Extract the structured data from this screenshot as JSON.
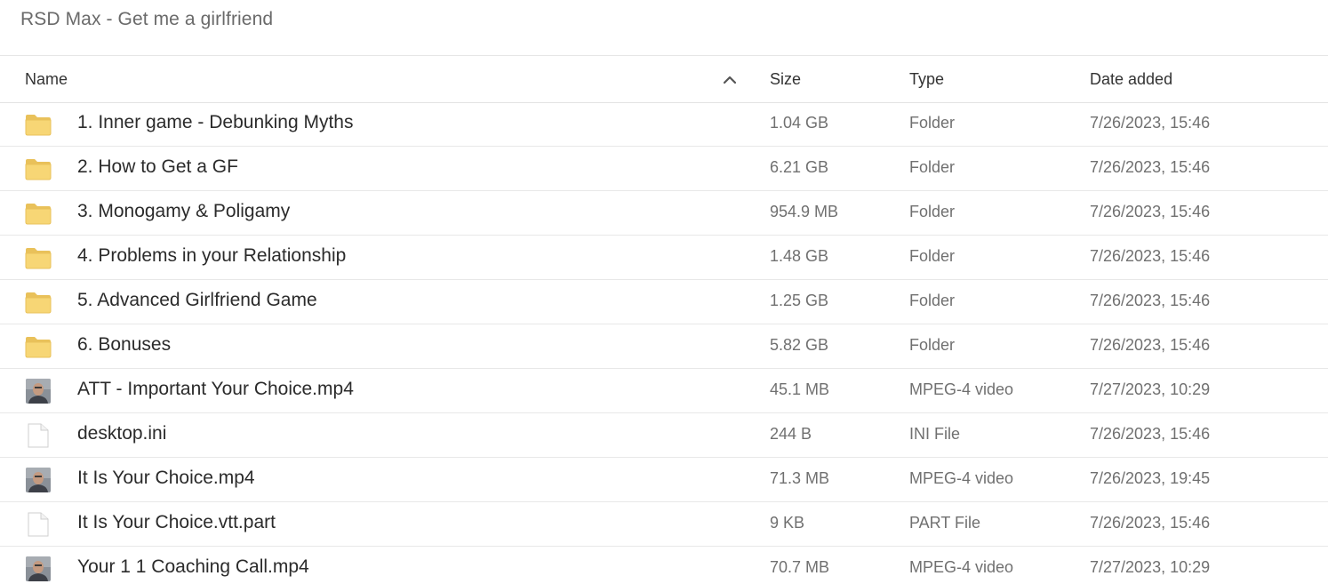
{
  "breadcrumb": "RSD Max - Get me a girlfriend",
  "columns": {
    "name": "Name",
    "size": "Size",
    "type": "Type",
    "date": "Date added"
  },
  "colors": {
    "folder": "#f7d675",
    "folder_dark": "#e9c15a",
    "file": "#ffffff"
  },
  "rows": [
    {
      "icon": "folder-icon",
      "name": "1. Inner game - Debunking Myths",
      "size": "1.04 GB",
      "type": "Folder",
      "date": "7/26/2023, 15:46"
    },
    {
      "icon": "folder-icon",
      "name": "2. How to Get a GF",
      "size": "6.21 GB",
      "type": "Folder",
      "date": "7/26/2023, 15:46"
    },
    {
      "icon": "folder-icon",
      "name": "3. Monogamy & Poligamy",
      "size": "954.9 MB",
      "type": "Folder",
      "date": "7/26/2023, 15:46"
    },
    {
      "icon": "folder-icon",
      "name": "4. Problems in your Relationship",
      "size": "1.48 GB",
      "type": "Folder",
      "date": "7/26/2023, 15:46"
    },
    {
      "icon": "folder-icon",
      "name": "5. Advanced Girlfriend Game",
      "size": "1.25 GB",
      "type": "Folder",
      "date": "7/26/2023, 15:46"
    },
    {
      "icon": "folder-icon",
      "name": "6. Bonuses",
      "size": "5.82 GB",
      "type": "Folder",
      "date": "7/26/2023, 15:46"
    },
    {
      "icon": "video-thumbnail-icon",
      "name": "ATT - Important Your Choice.mp4",
      "size": "45.1 MB",
      "type": "MPEG-4 video",
      "date": "7/27/2023, 10:29"
    },
    {
      "icon": "file-icon",
      "name": "desktop.ini",
      "size": "244 B",
      "type": "INI File",
      "date": "7/26/2023, 15:46"
    },
    {
      "icon": "video-thumbnail-icon",
      "name": "It Is Your Choice.mp4",
      "size": "71.3 MB",
      "type": "MPEG-4 video",
      "date": "7/26/2023, 19:45"
    },
    {
      "icon": "file-icon",
      "name": "It Is Your Choice.vtt.part",
      "size": "9 KB",
      "type": "PART File",
      "date": "7/26/2023, 15:46"
    },
    {
      "icon": "video-thumbnail-icon",
      "name": "Your 1 1 Coaching Call.mp4",
      "size": "70.7 MB",
      "type": "MPEG-4 video",
      "date": "7/27/2023, 10:29"
    }
  ]
}
